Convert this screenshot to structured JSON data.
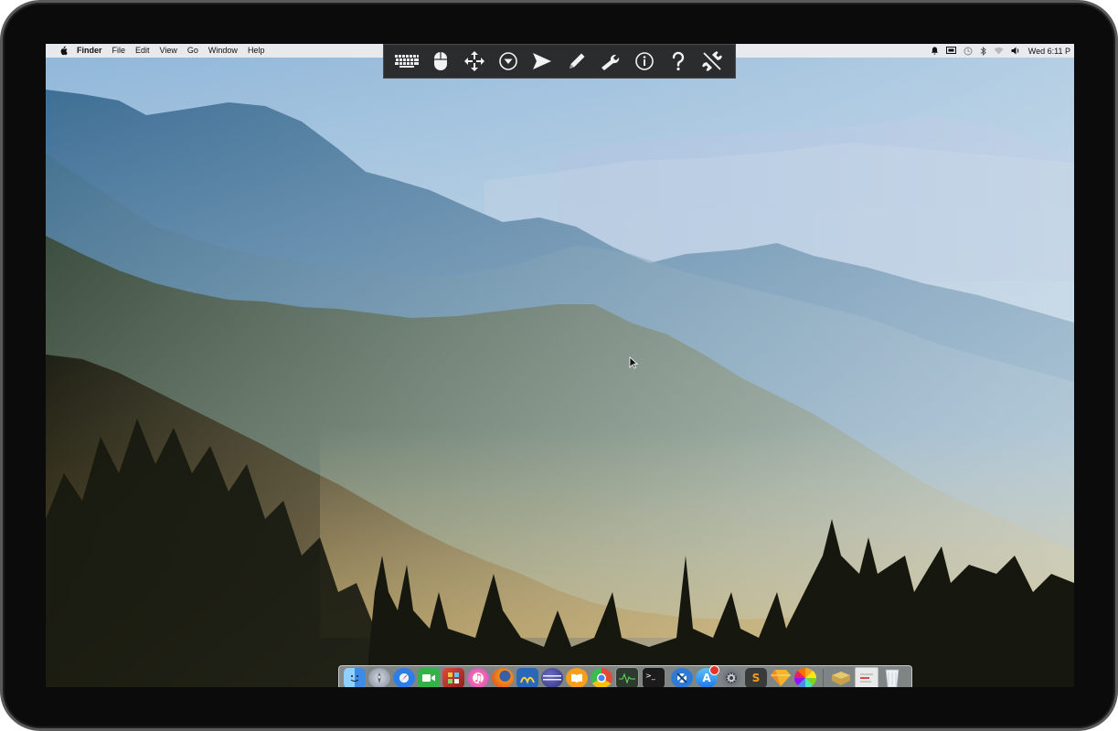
{
  "menubar": {
    "apple_icon": "apple-icon",
    "app_name": "Finder",
    "menus": [
      "File",
      "Edit",
      "View",
      "Go",
      "Window",
      "Help"
    ],
    "status_icons": [
      "notification-icon",
      "screen-icon",
      "time-machine-icon",
      "bluetooth-icon",
      "wifi-icon",
      "volume-icon"
    ],
    "clock": "Wed 6:11 P"
  },
  "toolbar": {
    "buttons": [
      "keyboard-icon",
      "mouse-icon",
      "move-icon",
      "dropdown-circle-icon",
      "send-icon",
      "pen-icon",
      "wrench-icon",
      "info-icon",
      "help-icon",
      "disconnect-icon"
    ]
  },
  "dock": {
    "apps": [
      {
        "name": "finder-icon",
        "color": "#3d8be6"
      },
      {
        "name": "launchpad-icon",
        "color": "#9aa4b3"
      },
      {
        "name": "safari-icon",
        "color": "#2f7ee8"
      },
      {
        "name": "facetime-icon",
        "color": "#33b24a"
      },
      {
        "name": "photo-booth-icon",
        "color": "#c0392b"
      },
      {
        "name": "itunes-icon",
        "color": "#f56ea4"
      },
      {
        "name": "firefox-icon",
        "color": "#e66b1f"
      },
      {
        "name": "wireshark-icon",
        "color": "#2b67b8"
      },
      {
        "name": "eclipse-icon",
        "color": "#2c2f7a"
      },
      {
        "name": "ibooks-icon",
        "color": "#f59f1b"
      },
      {
        "name": "chrome-icon",
        "color": "#dd4b39"
      },
      {
        "name": "activity-monitor-icon",
        "color": "#2d3a2d"
      },
      {
        "name": "terminal-icon",
        "color": "#1c1c1c"
      },
      {
        "name": "xcode-icon",
        "color": "#2e7bd6"
      },
      {
        "name": "app-store-icon",
        "color": "#1f8ef1"
      },
      {
        "name": "system-preferences-icon",
        "color": "#8a8f96"
      },
      {
        "name": "sublime-text-icon",
        "color": "#3a3a3a"
      },
      {
        "name": "sketch-icon",
        "color": "#f5b52a"
      },
      {
        "name": "photos-icon",
        "color": "#f2f2f2"
      }
    ],
    "extras": [
      {
        "name": "stack-folder-icon",
        "color": "#c9a14a"
      },
      {
        "name": "documents-stack-icon",
        "color": "#e9e9e9"
      },
      {
        "name": "trash-icon",
        "color": "#dfe4ea"
      }
    ]
  }
}
